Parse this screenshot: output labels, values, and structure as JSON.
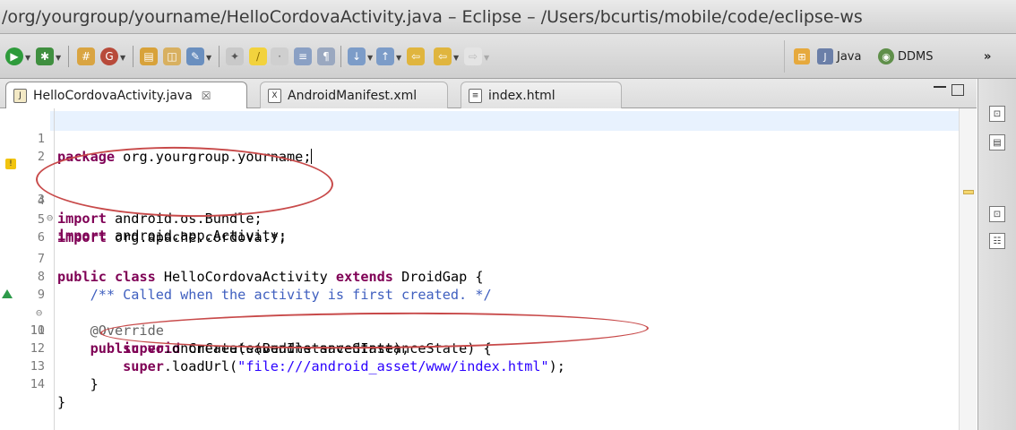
{
  "window": {
    "title": "/org/yourgroup/yourname/HelloCordovaActivity.java – Eclipse – /Users/bcurtis/mobile/code/eclipse-ws"
  },
  "toolbar": {
    "icons": [
      "run-icon",
      "debug-icon",
      "new-wizard-icon",
      "search-icon",
      "open-folder-icon",
      "open-task-icon",
      "pen-icon",
      "bulb-icon",
      "toggle-mark-occurrences-icon",
      "block-selection-icon",
      "show-whitespace-icon",
      "pilcrow-icon",
      "next-annotation-icon",
      "prev-annotation-icon",
      "back-icon",
      "forward-icon"
    ],
    "perspectives": [
      {
        "label": "Java",
        "icon": "java-perspective-icon"
      },
      {
        "label": "DDMS",
        "icon": "ddms-icon"
      }
    ],
    "overflow": "»"
  },
  "editor": {
    "tabs": [
      {
        "label": "HelloCordovaActivity.java",
        "close": "☒",
        "active": true,
        "icon": "java-file-icon"
      },
      {
        "label": "AndroidManifest.xml",
        "active": false,
        "icon": "xml-file-icon"
      },
      {
        "label": "index.html",
        "active": false,
        "icon": "html-file-icon"
      }
    ],
    "lines": [
      {
        "n": "1",
        "text": "package org.yourgroup.yourname;"
      },
      {
        "n": "2",
        "text": ""
      },
      {
        "n": "3",
        "text": "import android.app.Activity;"
      },
      {
        "n": "4",
        "text": "import android.os.Bundle;"
      },
      {
        "n": "5",
        "text": "import org.apache.cordova.*;"
      },
      {
        "n": "6",
        "text": ""
      },
      {
        "n": "7",
        "text": "public class HelloCordovaActivity extends DroidGap {"
      },
      {
        "n": "8",
        "text": "    /** Called when the activity is first created. */"
      },
      {
        "n": "9",
        "text": "    @Override"
      },
      {
        "n": "10",
        "text": "    public void onCreate(Bundle savedInstanceState) {"
      },
      {
        "n": "11",
        "text": "        super.onCreate(savedInstanceState);"
      },
      {
        "n": "12",
        "text": "        super.loadUrl(\"file:///android_asset/www/index.html\");"
      },
      {
        "n": "13",
        "text": "    }"
      },
      {
        "n": "14",
        "text": "}"
      }
    ]
  },
  "colors": {
    "keyword": "#7f0055",
    "string": "#2a00ff",
    "comment": "#3f5fbf",
    "annotation_ellipse": "#c84a4a",
    "current_line": "#e8f2fe"
  }
}
